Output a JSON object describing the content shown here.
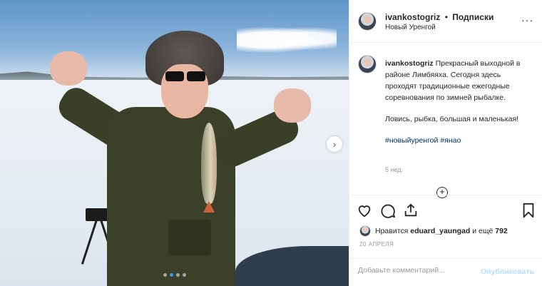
{
  "post": {
    "photo_alt": "",
    "carousel_dots": 4,
    "active_dot": 1
  },
  "header": {
    "username": "ivankostogriz",
    "separator": "•",
    "follow_label": "Подписки",
    "location": "Новый Уренгой",
    "more": "···"
  },
  "caption": {
    "username": "ivankostogriz",
    "text_1": "Прекрасный выходной в районе Лимбяяха. Сегодня здесь проходят традиционные ежегодные соревнования по зимней рыбалке.",
    "text_2": "Ловись, рыбка, большая и маленькая!",
    "tags": [
      "#новыйуренгой",
      "#янао"
    ],
    "time_ago": "5 нед.",
    "more_symbol": "+"
  },
  "actions": {
    "icons": [
      "heart-icon",
      "comment-icon",
      "share-icon",
      "bookmark-icon"
    ],
    "likes_prefix": "Нравится",
    "likes_user": "eduard_yaungad",
    "likes_mid": "и ещё",
    "likes_count": "792",
    "date": "20 АПРЕЛЯ"
  },
  "comment": {
    "placeholder": "Добавьте комментарий...",
    "publish_label": "Опубликовать"
  },
  "colors": {
    "link": "#003569",
    "publish_disabled": "#b2dffc",
    "active_dot": "#3897f0"
  }
}
